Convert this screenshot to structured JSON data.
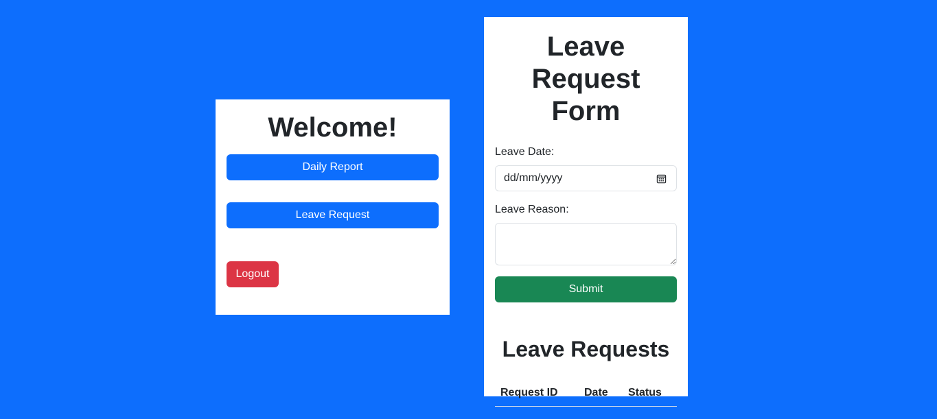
{
  "welcome": {
    "title": "Welcome!",
    "daily_report_label": "Daily Report",
    "leave_request_label": "Leave Request",
    "logout_label": "Logout"
  },
  "leave_form": {
    "title": "Leave Request Form",
    "date_label": "Leave Date:",
    "date_placeholder": "dd/mm/yyyy",
    "reason_label": "Leave Reason:",
    "reason_value": "",
    "submit_label": "Submit"
  },
  "requests": {
    "title": "Leave Requests",
    "columns": [
      "Request ID",
      "Date",
      "Status"
    ],
    "rows": []
  },
  "colors": {
    "background": "#0d6efd",
    "primary": "#0d6efd",
    "danger": "#dc3545",
    "success": "#198754"
  },
  "icons": {
    "date_picker": "calendar-icon"
  }
}
